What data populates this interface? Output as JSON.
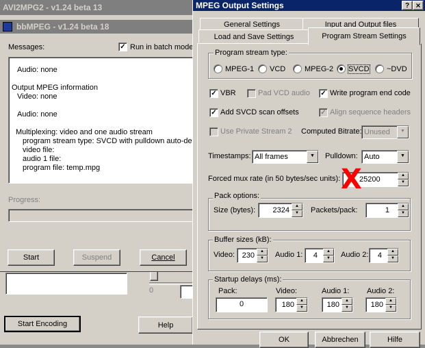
{
  "avi2mpg": {
    "title": "AVI2MPG2 - v1.24 beta 13"
  },
  "bbmpeg": {
    "title": "bbMPEG - v1.24 beta 18",
    "messages_label": "Messages:",
    "batch_label": "Run in batch mode",
    "batch_checked": true,
    "log_lines": [
      "Audio: none",
      "",
      "Output MPEG information",
      "Video: none",
      "",
      "Audio: none",
      "",
      "Multiplexing: video and one audio stream",
      "program stream type: SVCD with pulldown auto-dete",
      "video file:",
      "audio 1 file:",
      "program file: temp.mpg"
    ],
    "progress_label": "Progress:",
    "progress": 0,
    "buttons": {
      "start": "Start",
      "suspend": "Suspend",
      "cancel": "Cancel"
    },
    "behind": {
      "start_encoding": "Start Encoding",
      "help": "Help",
      "slider_value": "0"
    }
  },
  "mpeg": {
    "title": "MPEG Output Settings",
    "title_buttons": {
      "help": "?",
      "close": "×"
    },
    "tabs_back": [
      "General Settings",
      "Input and Output files"
    ],
    "tabs_front": [
      "Load and Save Settings",
      "Program Stream Settings"
    ],
    "active_tab": "Program Stream Settings",
    "stream_type": {
      "label": "Program stream type:",
      "options": [
        "MPEG-1",
        "VCD",
        "MPEG-2",
        "SVCD",
        "~DVD"
      ],
      "selected": "SVCD"
    },
    "checks": {
      "vbr": "VBR",
      "pad_vcd": "Pad VCD audio",
      "write_end": "Write program end code",
      "add_svcd": "Add SVCD scan offsets",
      "align_seq": "Align sequence headers",
      "private_stream": "Use Private Stream 2"
    },
    "computed_bitrate": {
      "label": "Computed Bitrate:",
      "value": "Unused"
    },
    "timestamps": {
      "label": "Timestamps:",
      "value": "All frames"
    },
    "pulldown": {
      "label": "Pulldown:",
      "value": "Auto"
    },
    "forced_mux": {
      "label": "Forced mux rate (in 50 bytes/sec units):",
      "value": "25200"
    },
    "annotation_mark": "X",
    "annotation_color": "#ff0000",
    "pack": {
      "label": "Pack options:",
      "size_label": "Size (bytes):",
      "size": "2324",
      "packets_label": "Packets/pack:",
      "packets": "1"
    },
    "buffer": {
      "label": "Buffer sizes (kB):",
      "video_label": "Video:",
      "video": "230",
      "audio1_label": "Audio 1:",
      "audio1": "4",
      "audio2_label": "Audio 2:",
      "audio2": "4"
    },
    "startup": {
      "label": "Startup delays (ms):",
      "pack_label": "Pack:",
      "pack": "0",
      "video_label": "Video:",
      "video": "180",
      "audio1_label": "Audio 1:",
      "audio1": "180",
      "audio2_label": "Audio 2:",
      "audio2": "180"
    },
    "buttons": {
      "ok": "OK",
      "cancel": "Abbrechen",
      "help": "Hilfe"
    }
  }
}
